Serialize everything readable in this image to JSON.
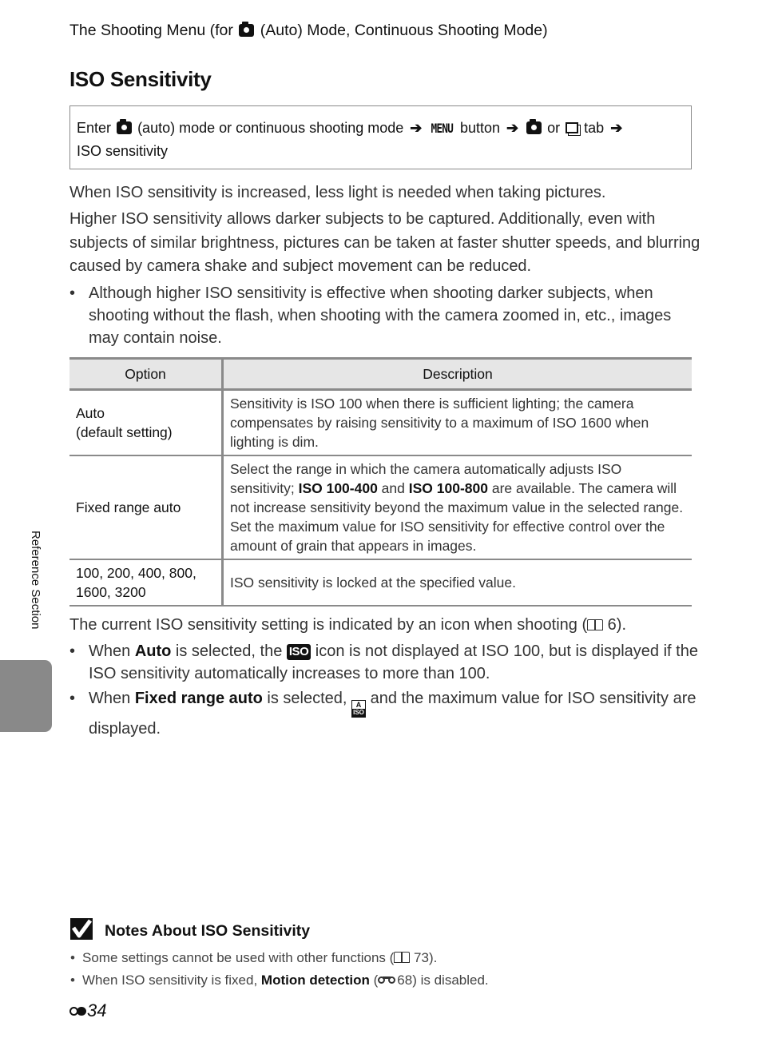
{
  "header": {
    "running_head_pre": "The Shooting Menu (for",
    "running_head_post": "(Auto) Mode, Continuous Shooting Mode)",
    "title": "ISO Sensitivity"
  },
  "menu_path": {
    "enter": "Enter",
    "auto_mode": "(auto) mode or continuous shooting mode",
    "menu_button_word": "MENU",
    "button": "button",
    "or": "or",
    "tab": "tab",
    "final": "ISO sensitivity",
    "arrow": "➔"
  },
  "intro": {
    "para1": "When ISO sensitivity is increased, less light is needed when taking pictures.",
    "para2": "Higher ISO sensitivity allows darker subjects to be captured. Additionally, even with subjects of similar brightness, pictures can be taken at faster shutter speeds, and blurring caused by camera shake and subject movement can be reduced.",
    "bullet1": "Although higher ISO sensitivity is effective when shooting darker subjects, when shooting without the flash, when shooting with the camera zoomed in, etc., images may contain noise."
  },
  "table": {
    "headers": [
      "Option",
      "Description"
    ],
    "rows": [
      {
        "option_line1": "Auto",
        "option_line2": "(default setting)",
        "description": "Sensitivity is ISO 100 when there is sufficient lighting; the camera compensates by raising sensitivity to a maximum of ISO 1600 when lighting is dim."
      },
      {
        "option": "Fixed range auto",
        "desc_pre": "Select the range in which the camera automatically adjusts ISO sensitivity; ",
        "desc_bold1": "ISO 100-400",
        "desc_mid": " and ",
        "desc_bold2": "ISO 100-800",
        "desc_post": " are available. The camera will not increase sensitivity beyond the maximum value in the selected range. Set the maximum value for ISO sensitivity for effective control over the amount of grain that appears in images."
      },
      {
        "option_line1": "100, 200, 400, 800,",
        "option_line2": "1600, 3200",
        "description": "ISO sensitivity is locked at the specified value."
      }
    ]
  },
  "after_table": {
    "para_pre": "The current ISO sensitivity setting is indicated by an icon when shooting (",
    "para_ref": "6",
    "para_post": ").",
    "bullet1_pre": "When ",
    "bullet1_bold": "Auto",
    "bullet1_mid": " is selected, the ",
    "bullet1_icon": "ISO",
    "bullet1_post": " icon is not displayed at ISO 100, but is displayed if the ISO sensitivity automatically increases to more than 100.",
    "bullet2_pre": "When ",
    "bullet2_bold": "Fixed range auto",
    "bullet2_mid": " is selected, ",
    "bullet2_icon_top": "A",
    "bullet2_icon_bottom": "ISO",
    "bullet2_post": " and the maximum value for ISO sensitivity are displayed."
  },
  "notes": {
    "title": "Notes About ISO Sensitivity",
    "item1_pre": "Some settings cannot be used with other functions (",
    "item1_ref": "73",
    "item1_post": ").",
    "item2_pre": "When ISO sensitivity is fixed, ",
    "item2_bold": "Motion detection",
    "item2_paren_open": " (",
    "item2_ref": "68",
    "item2_post": ") is disabled."
  },
  "side": {
    "section_label": "Reference Section"
  },
  "footer": {
    "page_number": "34"
  },
  "bullet_char": "•"
}
